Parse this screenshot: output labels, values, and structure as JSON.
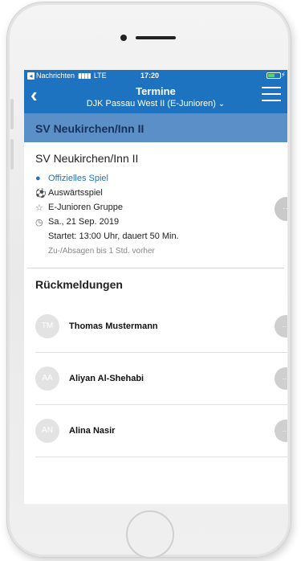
{
  "statusbar": {
    "back_app": "Nachrichten",
    "signal": "▮▮▮▮",
    "network": "LTE",
    "time": "17:20",
    "bolt": "⚡"
  },
  "navbar": {
    "title": "Termine",
    "subtitle": "DJK Passau West II (E-Junioren)",
    "back_icon": "chevron-left-icon",
    "menu_icon": "hamburger-menu-icon"
  },
  "team_header": "SV Neukirchen/Inn II",
  "event": {
    "opponent": "SV Neukirchen/Inn II",
    "official": "Offizielles Spiel",
    "away": "Auswärtsspiel",
    "group": "E-Junioren Gruppe",
    "date": "Sa., 21 Sep. 2019",
    "start": "Startet: 13:00 Uhr, dauert 50 Min.",
    "deadline": "Zu-/Absagen bis 1 Std. vorher",
    "more": "···"
  },
  "responses": {
    "title": "Rückmeldungen",
    "items": [
      {
        "initials": "TM",
        "name": "Thomas Mustermann",
        "more": "···"
      },
      {
        "initials": "AA",
        "name": "Aliyan Al-Shehabi",
        "more": "···"
      },
      {
        "initials": "AN",
        "name": "Alina Nasir",
        "more": "···"
      }
    ]
  },
  "colors": {
    "primary": "#1e73c0",
    "header_band": "#5a8fc8",
    "avatar": "#e3e3e3"
  }
}
